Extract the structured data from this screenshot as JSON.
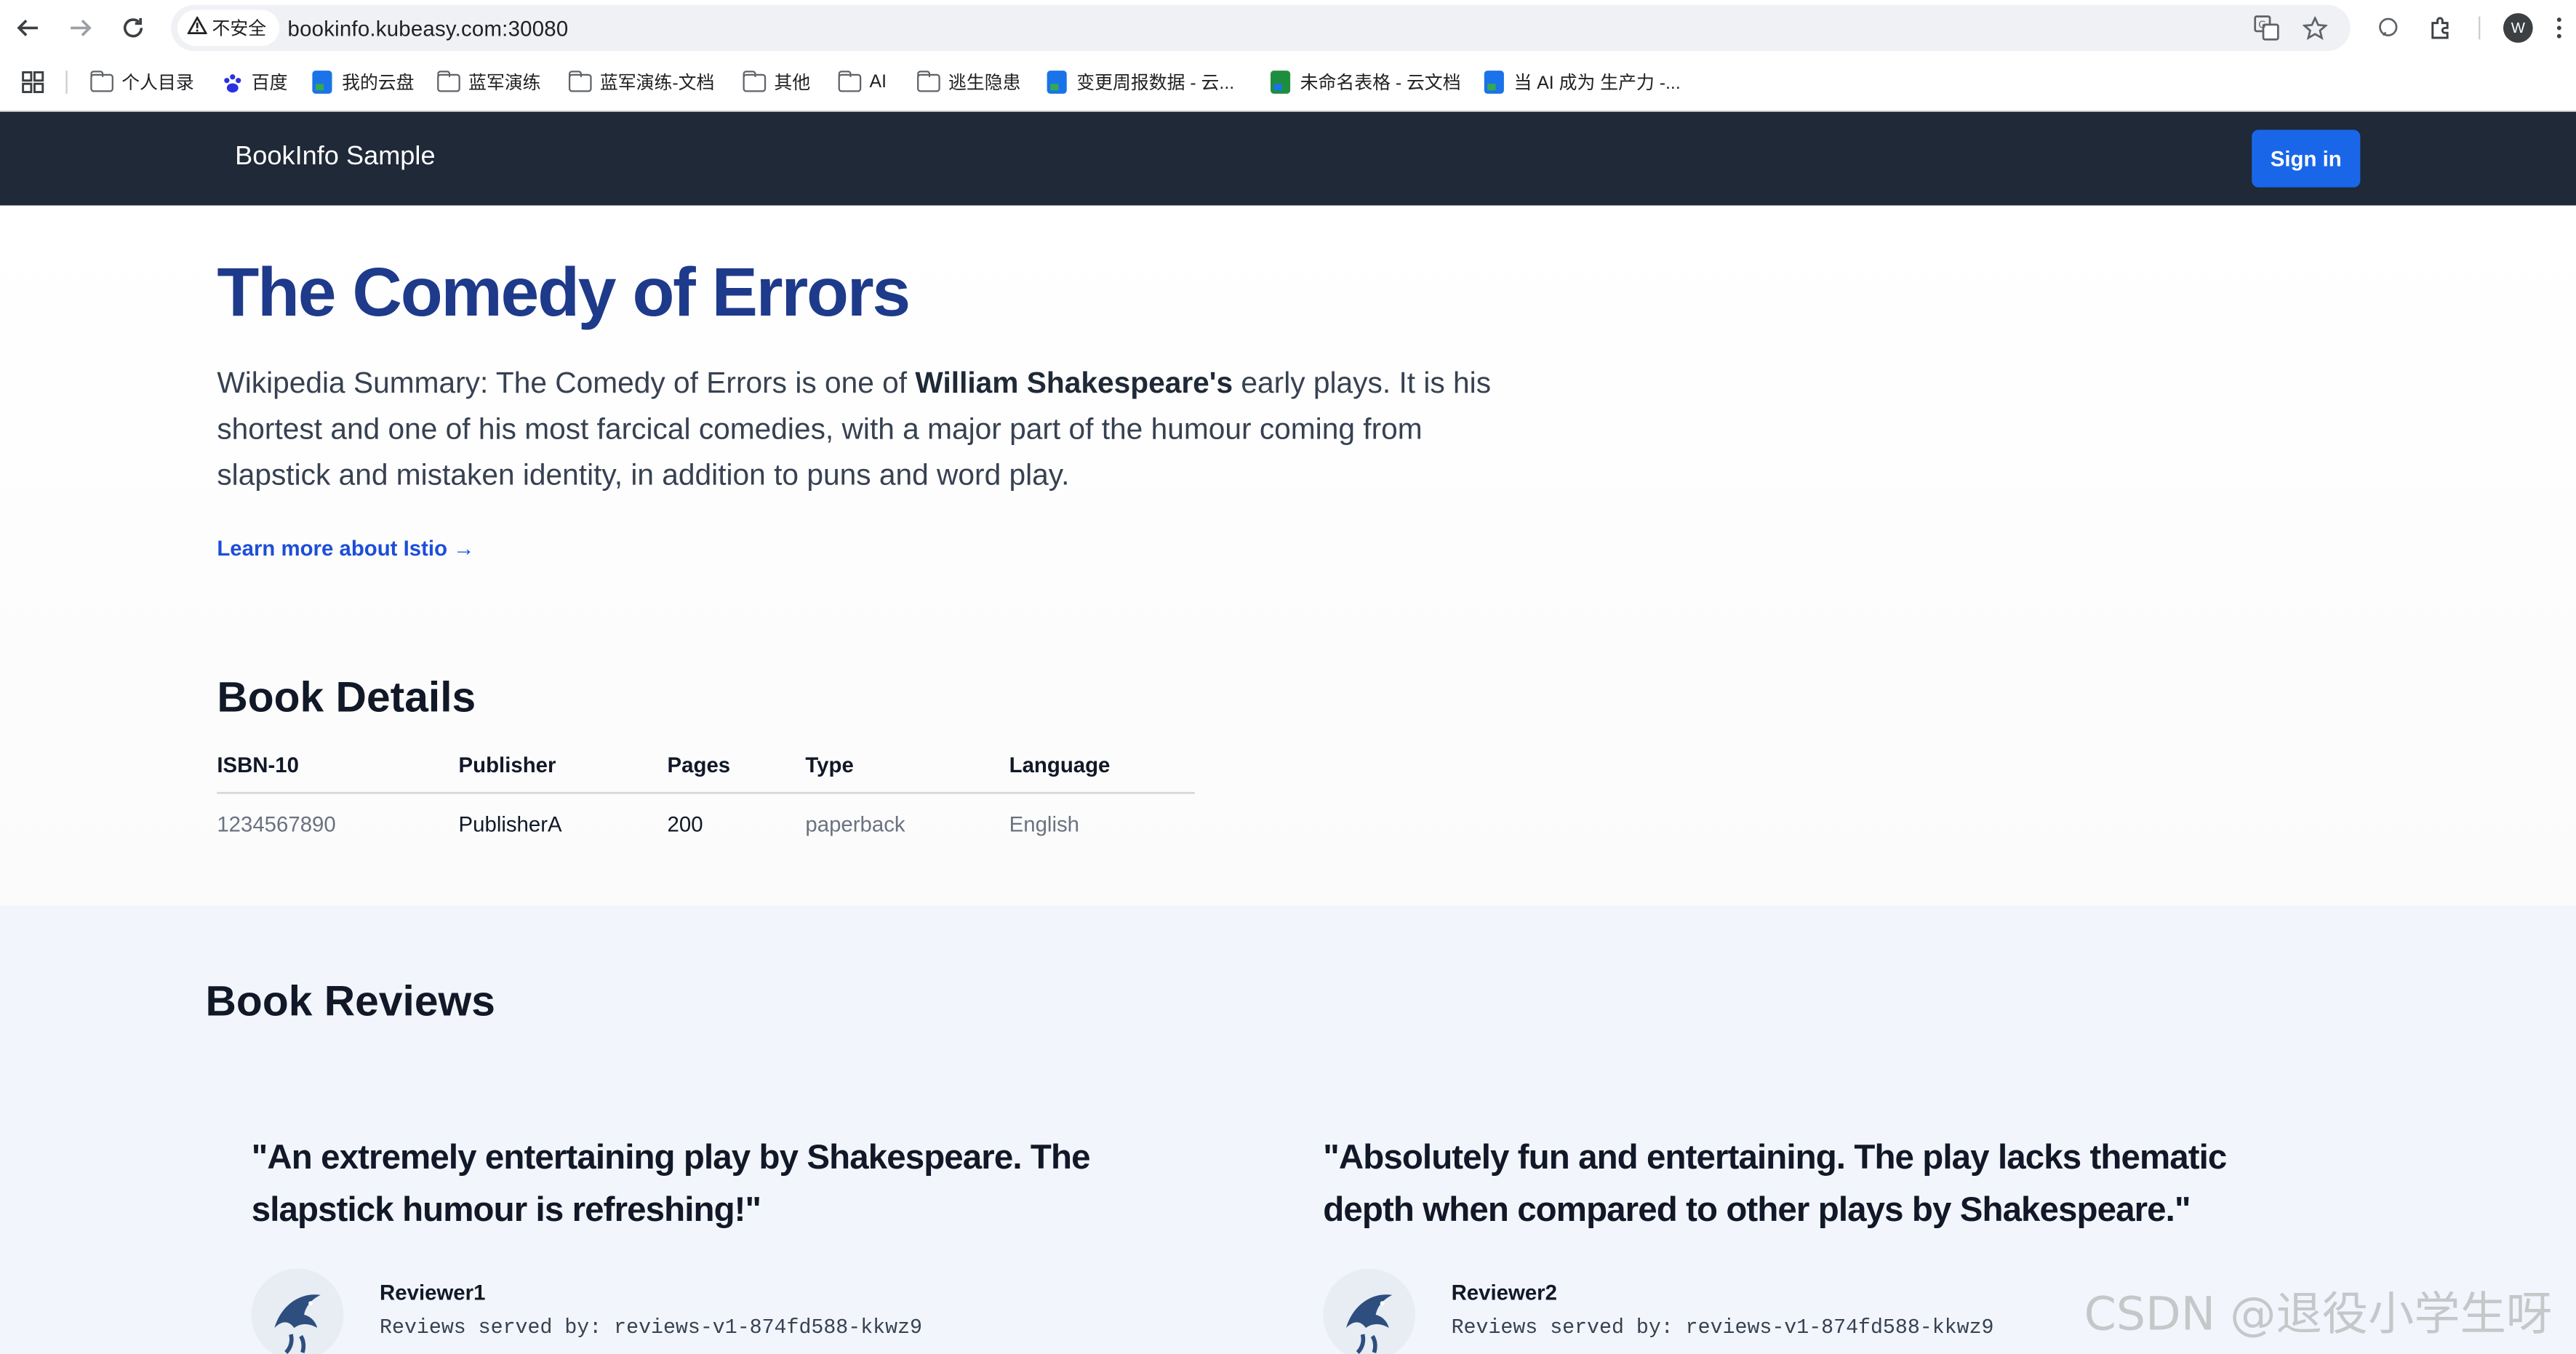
{
  "browser": {
    "security_label": "不安全",
    "url": "bookinfo.kubeasy.com:30080",
    "profile_initial": "W",
    "bookmarks": [
      {
        "label": "个人目录",
        "icon": "folder-icon"
      },
      {
        "label": "百度",
        "icon": "baidu-icon"
      },
      {
        "label": "我的云盘",
        "icon": "cloud-doc-icon"
      },
      {
        "label": "蓝军演练",
        "icon": "folder-icon"
      },
      {
        "label": "蓝军演练-文档",
        "icon": "folder-icon"
      },
      {
        "label": "其他",
        "icon": "folder-icon"
      },
      {
        "label": "AI",
        "icon": "folder-icon"
      },
      {
        "label": "逃生隐患",
        "icon": "folder-icon"
      },
      {
        "label": "变更周报数据 - 云...",
        "icon": "cloud-doc-icon"
      },
      {
        "label": "未命名表格 - 云文档",
        "icon": "sheet-doc-icon"
      },
      {
        "label": "当 AI 成为 生产力 -...",
        "icon": "cloud-doc-icon"
      }
    ]
  },
  "app": {
    "brand": "BookInfo Sample",
    "signin_label": "Sign in"
  },
  "book": {
    "title": "The Comedy of Errors",
    "summary_prefix": "Wikipedia Summary: The Comedy of Errors is one of ",
    "summary_bold": "William Shakespeare's",
    "summary_suffix": " early plays. It is his shortest and one of his most farcical comedies, with a major part of the humour coming from slapstick and mistaken identity, in addition to puns and word play.",
    "learn_more": "Learn more about Istio →"
  },
  "details": {
    "title": "Book Details",
    "headers": [
      "ISBN-10",
      "Publisher",
      "Pages",
      "Type",
      "Language"
    ],
    "row": [
      "1234567890",
      "PublisherA",
      "200",
      "paperback",
      "English"
    ]
  },
  "reviews": {
    "title": "Book Reviews",
    "items": [
      {
        "text": "\"An extremely entertaining play by Shakespeare. The slapstick humour is refreshing!\"",
        "reviewer": "Reviewer1",
        "served_by": "Reviews served by: reviews-v1-874fd588-kkwz9"
      },
      {
        "text": "\"Absolutely fun and entertaining. The play lacks thematic depth when compared to other plays by Shakespeare.\"",
        "reviewer": "Reviewer2",
        "served_by": "Reviews served by: reviews-v1-874fd588-kkwz9"
      }
    ]
  },
  "watermark": "CSDN @退役小学生呀",
  "colors": {
    "navbar": "#1f2937",
    "accent": "#1a66e8",
    "title": "#1e3a8a",
    "reviews_bg": "#f2f5fb"
  }
}
